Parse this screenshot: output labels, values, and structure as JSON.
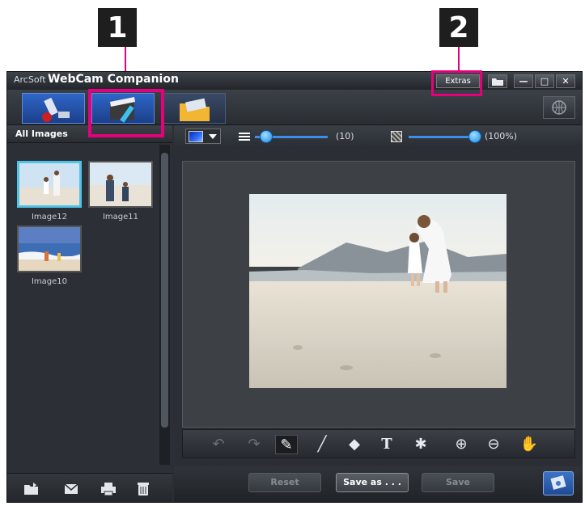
{
  "callouts": [
    "1",
    "2"
  ],
  "titlebar": {
    "brand": "ArcSoft",
    "app_name": "WebCam Companion",
    "extras_label": "Extras",
    "open_folder_icon": "folder-open-icon",
    "minimize_label": "—",
    "maximize_label": "□",
    "close_label": "✕"
  },
  "modes": [
    {
      "name": "capture",
      "icon": "webcam-icon",
      "active": false
    },
    {
      "name": "edit",
      "icon": "clapper-pencil-icon",
      "active": true
    },
    {
      "name": "manage",
      "icon": "folder-icon",
      "active": false
    }
  ],
  "left_panel": {
    "header": "All Images",
    "thumbnails": [
      {
        "label": "Image12",
        "selected": true
      },
      {
        "label": "Image11",
        "selected": false
      },
      {
        "label": "Image10",
        "selected": false
      }
    ],
    "bottom_icons": [
      "import-folder-icon",
      "email-icon",
      "print-icon",
      "delete-icon"
    ]
  },
  "toolbar": {
    "brush_color": "#1f5fe0",
    "line_width_value": "(10)",
    "line_width_level": 0.15,
    "opacity_value": "(100%)",
    "opacity_level": 1.0
  },
  "edit_tools": [
    "undo-icon",
    "redo-icon",
    "pen-icon",
    "line-icon",
    "eraser-icon",
    "text-icon",
    "stamp-icon",
    "zoom-in-icon",
    "zoom-out-icon",
    "hand-icon"
  ],
  "edit_tool_glyphs": {
    "undo": "↶",
    "redo": "↷",
    "pen": "✎",
    "line": "╱",
    "eraser": "◆",
    "text": "T",
    "stamp": "✱",
    "zoom_in": "⊕",
    "zoom_out": "⊖",
    "hand": "✋"
  },
  "actions": {
    "reset_label": "Reset",
    "save_as_label": "Save as . . .",
    "save_label": "Save"
  },
  "colors": {
    "highlight": "#e6007e",
    "selection": "#4fc3e8",
    "accent": "#2e66c8"
  }
}
